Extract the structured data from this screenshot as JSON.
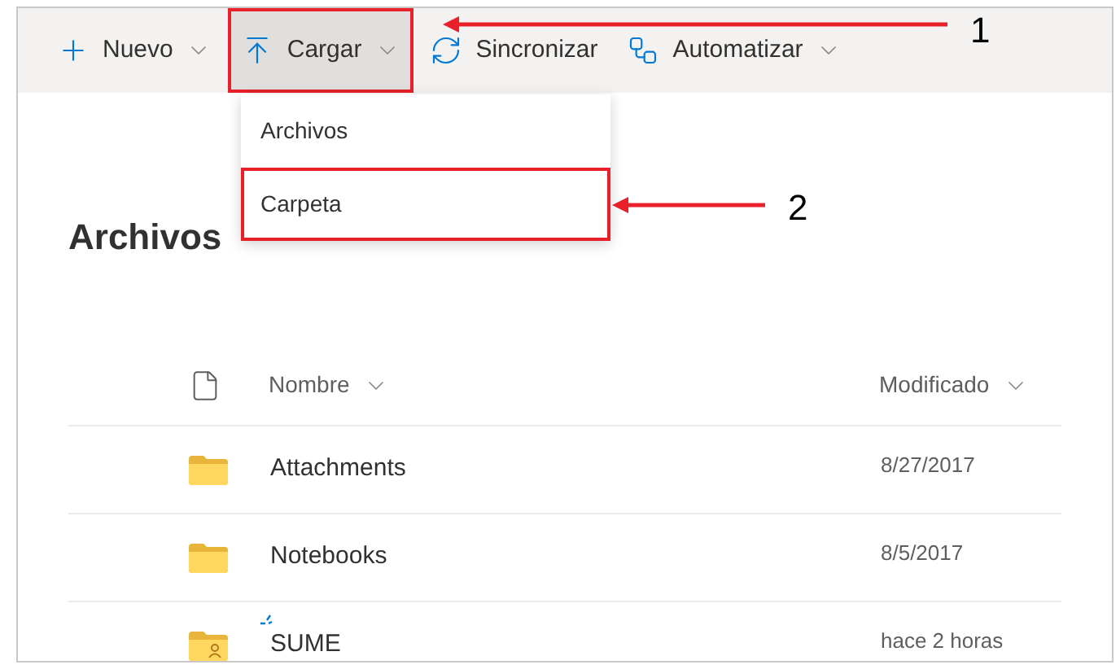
{
  "toolbar": [
    {
      "kind": "new",
      "label": "Nuevo",
      "selected": false,
      "dropdown": true,
      "annotated": false
    },
    {
      "kind": "upload",
      "label": "Cargar",
      "selected": true,
      "dropdown": true,
      "annotated": true
    },
    {
      "kind": "sync",
      "label": "Sincronizar",
      "selected": false,
      "dropdown": false,
      "annotated": false
    },
    {
      "kind": "automate",
      "label": "Automatizar",
      "selected": false,
      "dropdown": true,
      "annotated": false
    }
  ],
  "upload_menu": {
    "items": [
      {
        "label": "Archivos",
        "annotated": false
      },
      {
        "label": "Carpeta",
        "annotated": true
      }
    ]
  },
  "heading": "Archivos",
  "table": {
    "columns": [
      "Nombre",
      "Modificado"
    ],
    "rows": [
      {
        "kind": "folder",
        "name": "Attachments",
        "modified": "8/27/2017",
        "new": false
      },
      {
        "kind": "folder",
        "name": "Notebooks",
        "modified": "8/5/2017",
        "new": false
      },
      {
        "kind": "shared-folder",
        "name": "SUME",
        "modified": "hace 2 horas",
        "new": true
      }
    ]
  },
  "annotations": [
    {
      "label": "1"
    },
    {
      "label": "2"
    }
  ]
}
